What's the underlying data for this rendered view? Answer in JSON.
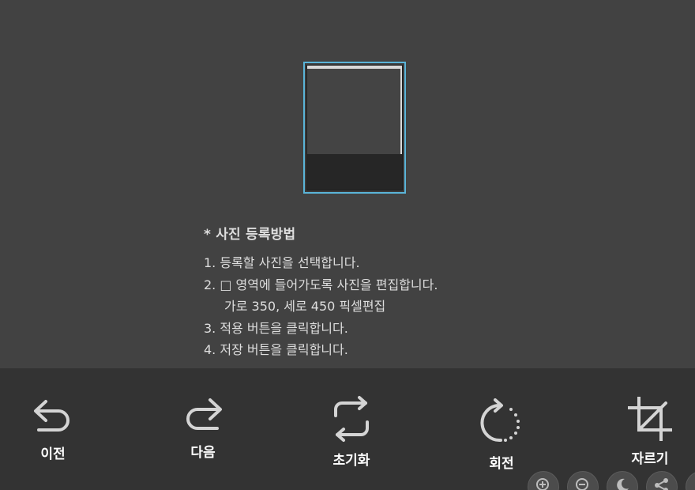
{
  "instructions": {
    "title": "* 사진 등록방법",
    "lines": [
      "1. 등록할 사진을 선택합니다.",
      "2. □ 영역에 들어가도록 사진을 편집합니다.",
      "가로 350, 세로 450 픽셀편집",
      "3. 적용 버튼을 클릭합니다.",
      "4. 저장 버튼을 클릭합니다."
    ]
  },
  "toolbar": {
    "undo_label": "이전",
    "redo_label": "다음",
    "reset_label": "초기화",
    "rotate_label": "회전",
    "crop_label": "자르기"
  },
  "colors": {
    "background": "#424242",
    "toolbar": "#333333",
    "crop_frame_accent": "#5ab4d8",
    "icon": "#d4d4d4"
  },
  "icons": {
    "undo": "undo-arrow-icon",
    "redo": "redo-arrow-icon",
    "reset": "swap-arrows-icon",
    "rotate": "rotate-icon",
    "crop": "crop-icon",
    "zoom_in": "zoom-in-icon",
    "zoom_out": "zoom-out-icon",
    "night_mode": "moon-icon",
    "share": "share-icon"
  }
}
